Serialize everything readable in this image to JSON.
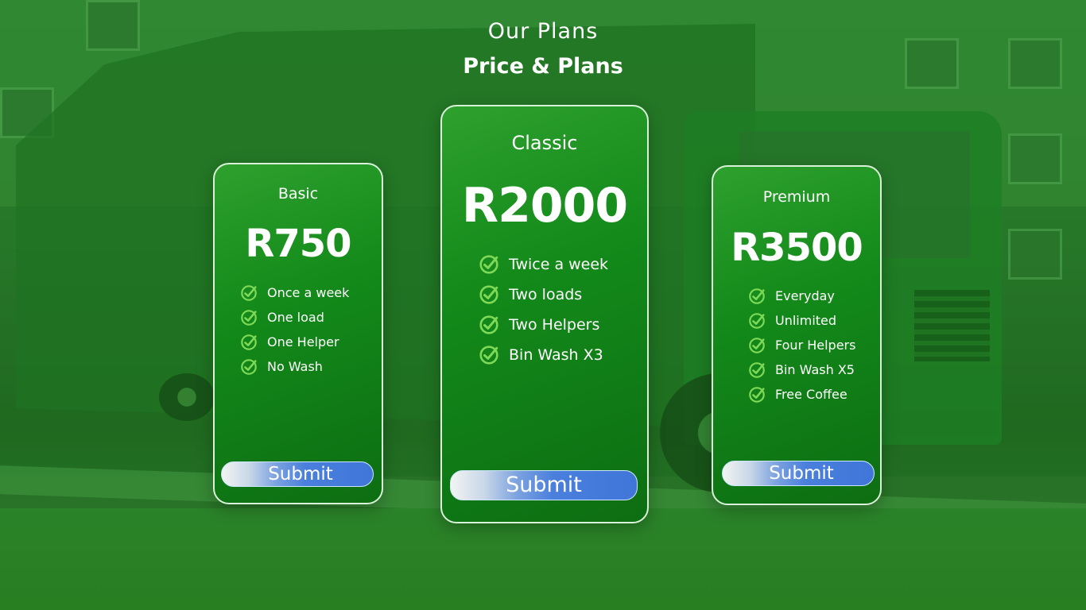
{
  "header": {
    "sub_title": "Our Plans",
    "title": "Price & Plans"
  },
  "colors": {
    "card_green": "#138a1a",
    "button_blue": "#4a7fdc",
    "check_green": "#7ed957"
  },
  "icons": {
    "feature": "check-circle-icon"
  },
  "plans": [
    {
      "name": "Basic",
      "price": "R750",
      "features": [
        "Once a week",
        "One load",
        "One Helper",
        "No Wash"
      ],
      "button_label": "Submit"
    },
    {
      "name": "Classic",
      "price": "R2000",
      "features": [
        "Twice a week",
        "Two loads",
        "Two Helpers",
        "Bin Wash X3"
      ],
      "button_label": "Submit"
    },
    {
      "name": "Premium",
      "price": "R3500",
      "features": [
        "Everyday",
        "Unlimited",
        "Four Helpers",
        "Bin Wash X5",
        "Free Coffee"
      ],
      "button_label": "Submit"
    }
  ]
}
